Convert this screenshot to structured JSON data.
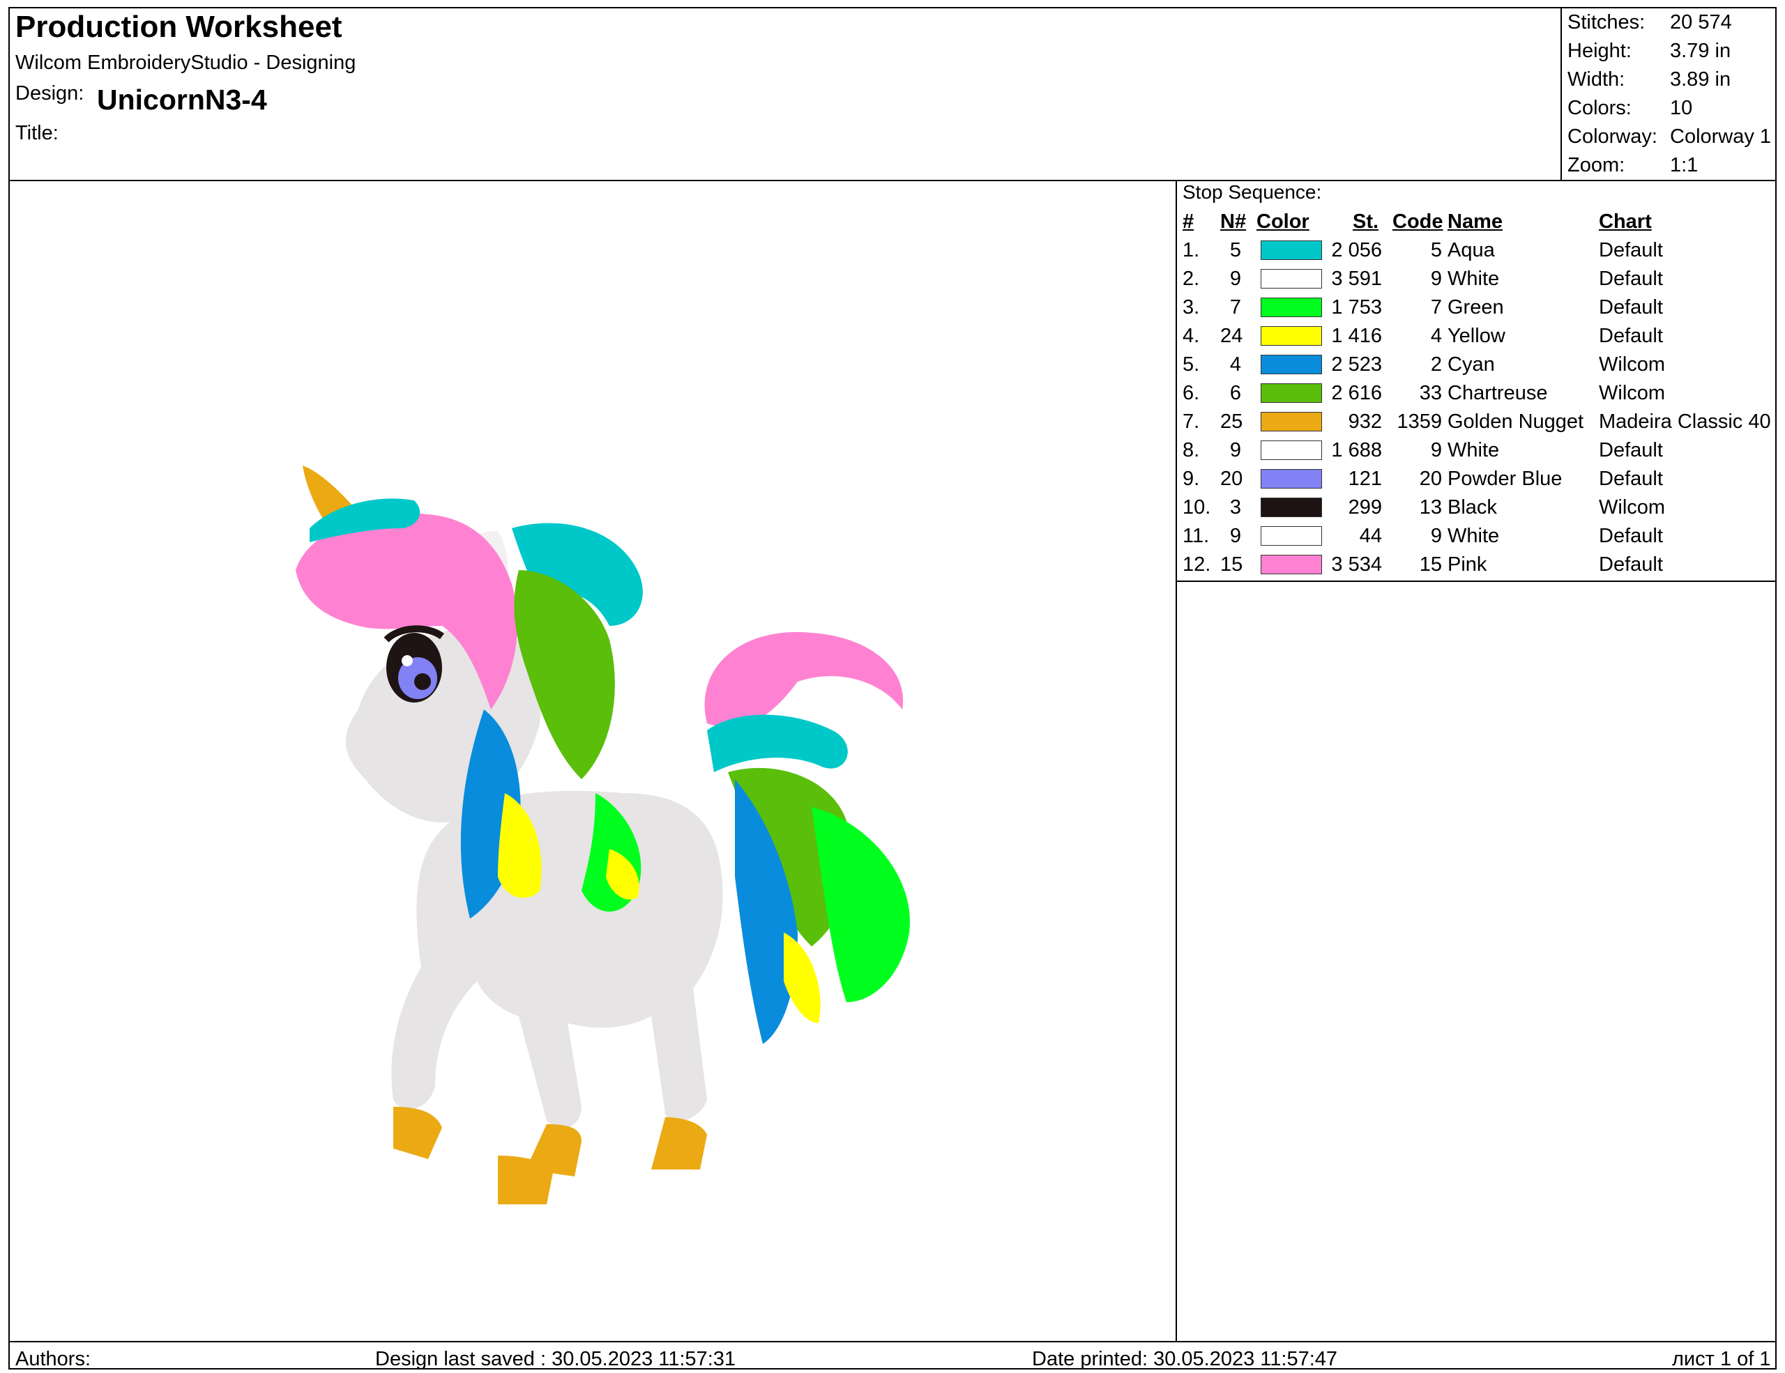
{
  "header": {
    "title": "Production Worksheet",
    "app": "Wilcom EmbroideryStudio - Designing",
    "design_label": "Design:",
    "design_value": "UnicornN3-4",
    "title_label": "Title:"
  },
  "stats": [
    {
      "label": "Stitches:",
      "value": "20 574"
    },
    {
      "label": "Height:",
      "value": "3.79 in"
    },
    {
      "label": "Width:",
      "value": "3.89 in"
    },
    {
      "label": "Colors:",
      "value": "10"
    },
    {
      "label": "Colorway:",
      "value": "Colorway 1"
    },
    {
      "label": "Zoom:",
      "value": "1:1"
    }
  ],
  "sequence": {
    "title": "Stop Sequence:",
    "headers": {
      "num": "#",
      "n": "N#",
      "color": "Color",
      "st": "St.",
      "code": "Code",
      "name": "Name",
      "chart": "Chart"
    },
    "rows": [
      {
        "num": "1.",
        "n": "5",
        "color": "#00c8c8",
        "st": "2 056",
        "code": "5",
        "name": "Aqua",
        "chart": "Default"
      },
      {
        "num": "2.",
        "n": "9",
        "color": "#ffffff",
        "st": "3 591",
        "code": "9",
        "name": "White",
        "chart": "Default"
      },
      {
        "num": "3.",
        "n": "7",
        "color": "#00ff1e",
        "st": "1 753",
        "code": "7",
        "name": "Green",
        "chart": "Default"
      },
      {
        "num": "4.",
        "n": "24",
        "color": "#ffff00",
        "st": "1 416",
        "code": "4",
        "name": "Yellow",
        "chart": "Default"
      },
      {
        "num": "5.",
        "n": "4",
        "color": "#0a8cdc",
        "st": "2 523",
        "code": "2",
        "name": "Cyan",
        "chart": "Wilcom"
      },
      {
        "num": "6.",
        "n": "6",
        "color": "#5abe0a",
        "st": "2 616",
        "code": "33",
        "name": "Chartreuse",
        "chart": "Wilcom"
      },
      {
        "num": "7.",
        "n": "25",
        "color": "#ebaa14",
        "st": "932",
        "code": "1359",
        "name": "Golden Nugget",
        "chart": "Madeira Classic 40"
      },
      {
        "num": "8.",
        "n": "9",
        "color": "#ffffff",
        "st": "1 688",
        "code": "9",
        "name": "White",
        "chart": "Default"
      },
      {
        "num": "9.",
        "n": "20",
        "color": "#8282f5",
        "st": "121",
        "code": "20",
        "name": "Powder Blue",
        "chart": "Default"
      },
      {
        "num": "10.",
        "n": "3",
        "color": "#1e1414",
        "st": "299",
        "code": "13",
        "name": "Black",
        "chart": "Wilcom"
      },
      {
        "num": "11.",
        "n": "9",
        "color": "#ffffff",
        "st": "44",
        "code": "9",
        "name": "White",
        "chart": "Default"
      },
      {
        "num": "12.",
        "n": "15",
        "color": "#ff82d2",
        "st": "3 534",
        "code": "15",
        "name": "Pink",
        "chart": "Default"
      }
    ]
  },
  "footer": {
    "authors": "Authors:",
    "saved": "Design last saved : 30.05.2023 11:57:31",
    "printed": "Date printed: 30.05.2023 11:57:47",
    "page": "лист 1 of 1"
  }
}
